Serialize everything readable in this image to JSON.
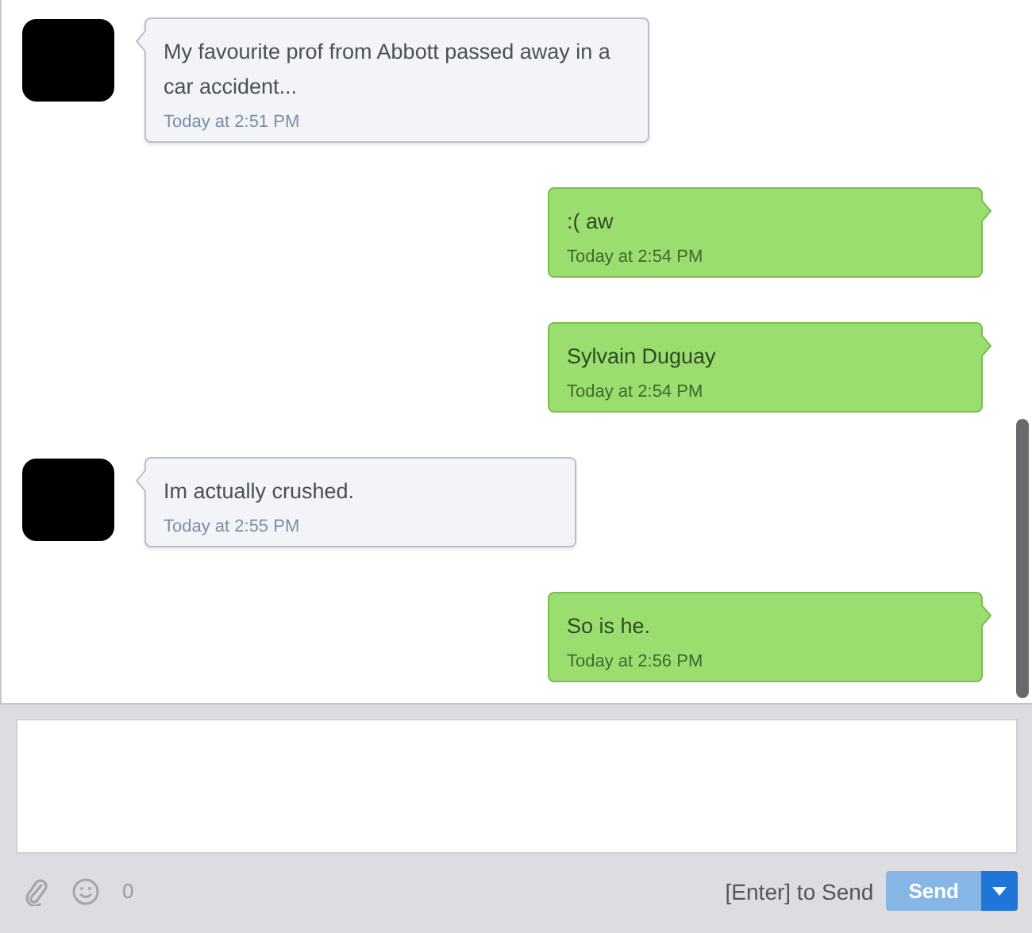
{
  "messages": [
    {
      "kind": "received",
      "text": "My favourite prof from Abbott passed away in a car accident...",
      "time": "Today at 2:51 PM"
    },
    {
      "kind": "sent",
      "text": ":( aw",
      "time": "Today at 2:54 PM"
    },
    {
      "kind": "sent",
      "text": "Sylvain Duguay",
      "time": "Today at 2:54 PM"
    },
    {
      "kind": "received",
      "text": "Im actually crushed.",
      "time": "Today at 2:55 PM"
    },
    {
      "kind": "sent",
      "text": "So is he.",
      "time": "Today at 2:56 PM"
    }
  ],
  "composer": {
    "counter": "0",
    "hint": "[Enter] to Send",
    "send": {
      "label": "Send",
      "disabled": true
    }
  }
}
